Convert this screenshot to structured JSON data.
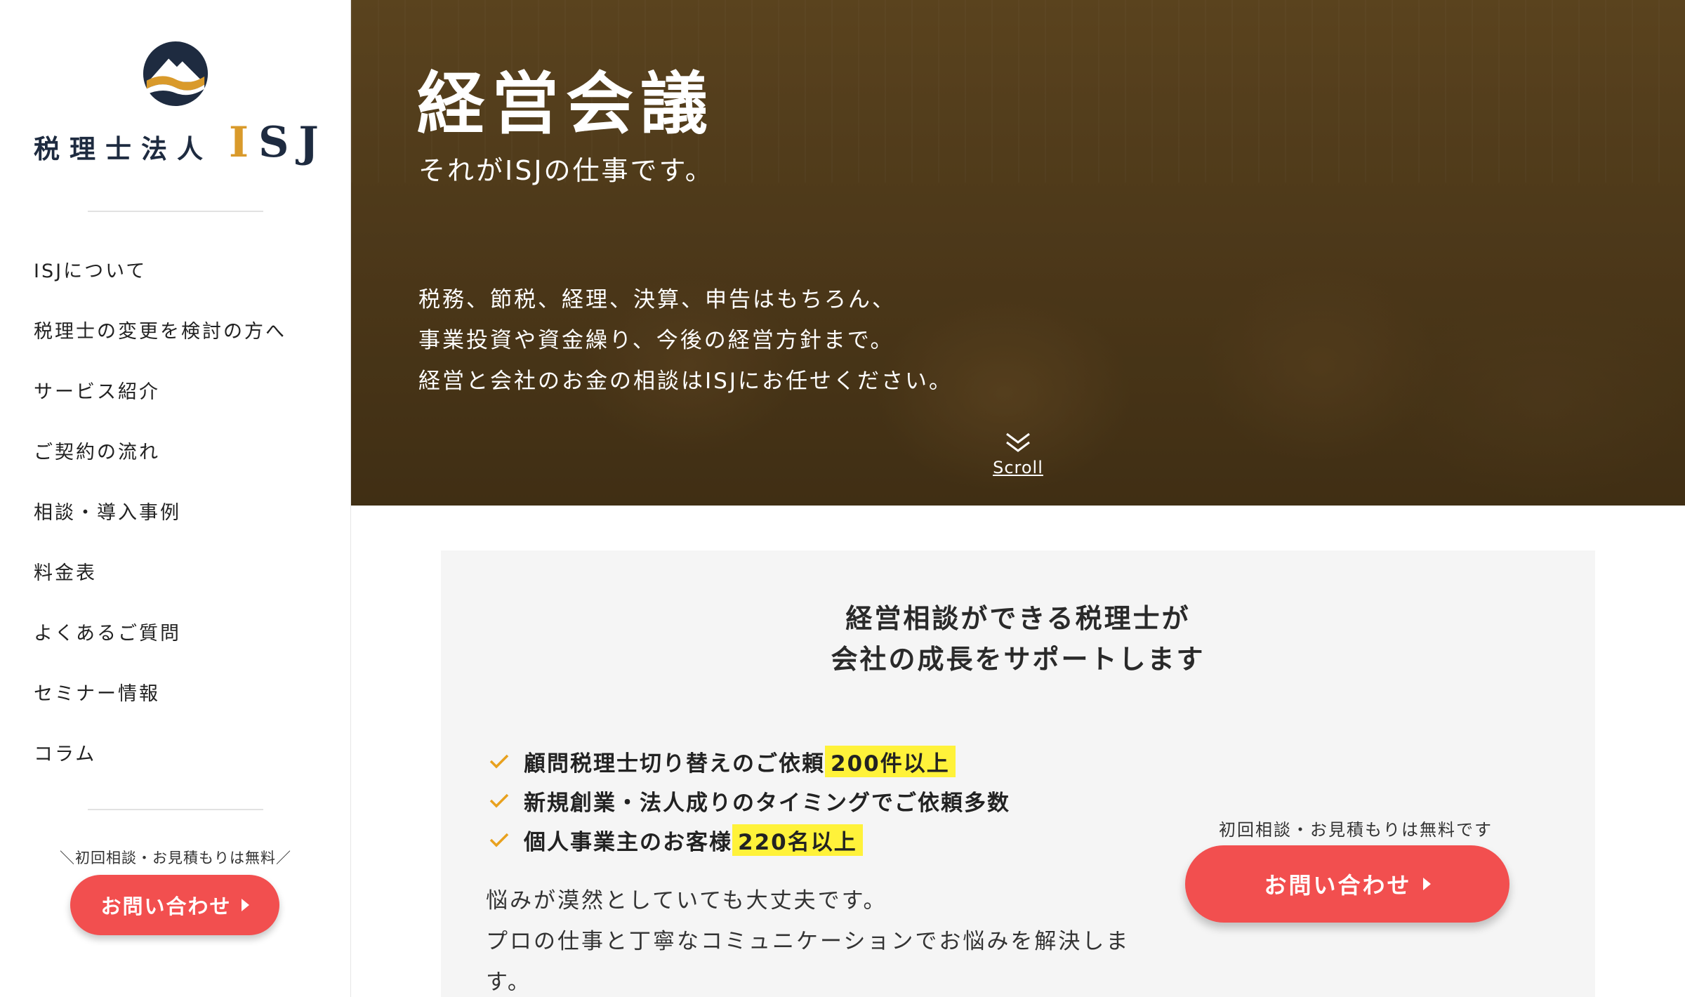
{
  "sidebar": {
    "logo": {
      "jp": "税理士法人",
      "en_accent": "I",
      "en_rest": "SJ"
    },
    "nav": [
      {
        "label": "ISJについて"
      },
      {
        "label": "税理士の変更を検討の方へ"
      },
      {
        "label": "サービス紹介"
      },
      {
        "label": "ご契約の流れ"
      },
      {
        "label": "相談・導入事例"
      },
      {
        "label": "料金表"
      },
      {
        "label": "よくあるご質問"
      },
      {
        "label": "セミナー情報"
      },
      {
        "label": "コラム"
      }
    ],
    "cta_caption": "＼初回相談・お見積もりは無料／",
    "cta_label": "お問い合わせ"
  },
  "hero": {
    "title": "経営会議",
    "subtitle": "それがISJの仕事です。",
    "description": [
      "税務、節税、経理、決算、申告はもちろん、",
      "事業投資や資金繰り、今後の経営方針まで。",
      "経営と会社のお金の相談はISJにお任せください。"
    ],
    "scroll_label": "Scroll"
  },
  "feature": {
    "heading": [
      "経営相談ができる税理士が",
      "会社の成長をサポートします"
    ],
    "checks": [
      {
        "text": "顧問税理士切り替えのご依頼",
        "highlight": "200件以上"
      },
      {
        "text": "新規創業・法人成りのタイミングでご依頼多数",
        "highlight": ""
      },
      {
        "text": "個人事業主のお客様",
        "highlight": "220名以上"
      }
    ],
    "body": [
      "悩みが漠然としていても大丈夫です。",
      "プロの仕事と丁寧なコミュニケーションでお悩みを解決しま",
      "す。"
    ],
    "cta_caption": "初回相談・お見積もりは無料です",
    "cta_label": "お問い合わせ"
  },
  "colors": {
    "brand_navy": "#1e2b40",
    "brand_gold": "#d99a2b",
    "cta_red": "#f24f4f",
    "highlight_yellow": "#fff23a",
    "check_orange": "#e8a11e"
  },
  "icons": {
    "logo_mark": "mountain-wave-logo-icon",
    "scroll": "double-chevron-down-icon",
    "cta_arrow": "caret-right-icon",
    "check": "check-icon"
  }
}
